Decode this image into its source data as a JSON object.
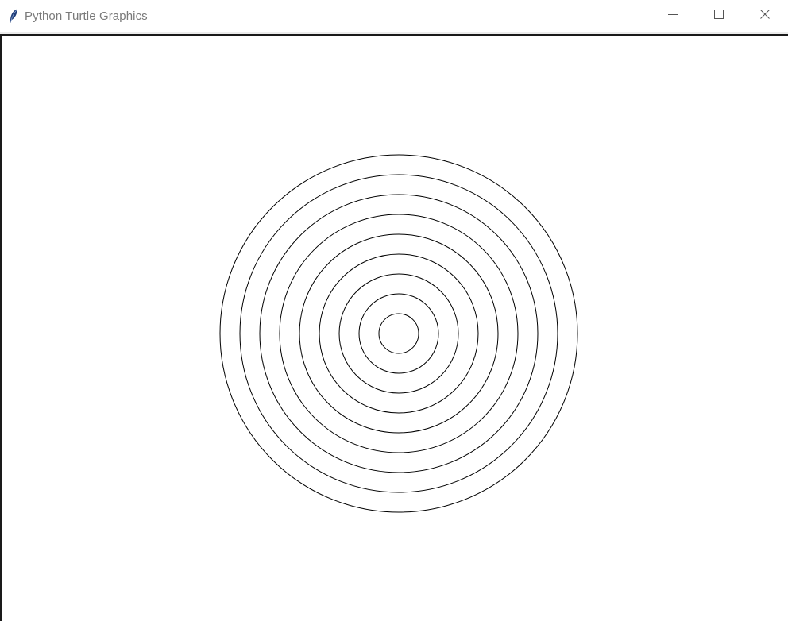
{
  "window": {
    "title": "Python Turtle Graphics",
    "app_icon": "feather-icon",
    "controls": [
      {
        "name": "minimize-button",
        "icon": "minimize-icon"
      },
      {
        "name": "maximize-button",
        "icon": "maximize-icon"
      },
      {
        "name": "close-button",
        "icon": "close-icon"
      }
    ]
  },
  "canvas": {
    "background": "#ffffff",
    "stroke_color": "#000000",
    "shape": "concentric-circles",
    "circle_count": 9
  }
}
